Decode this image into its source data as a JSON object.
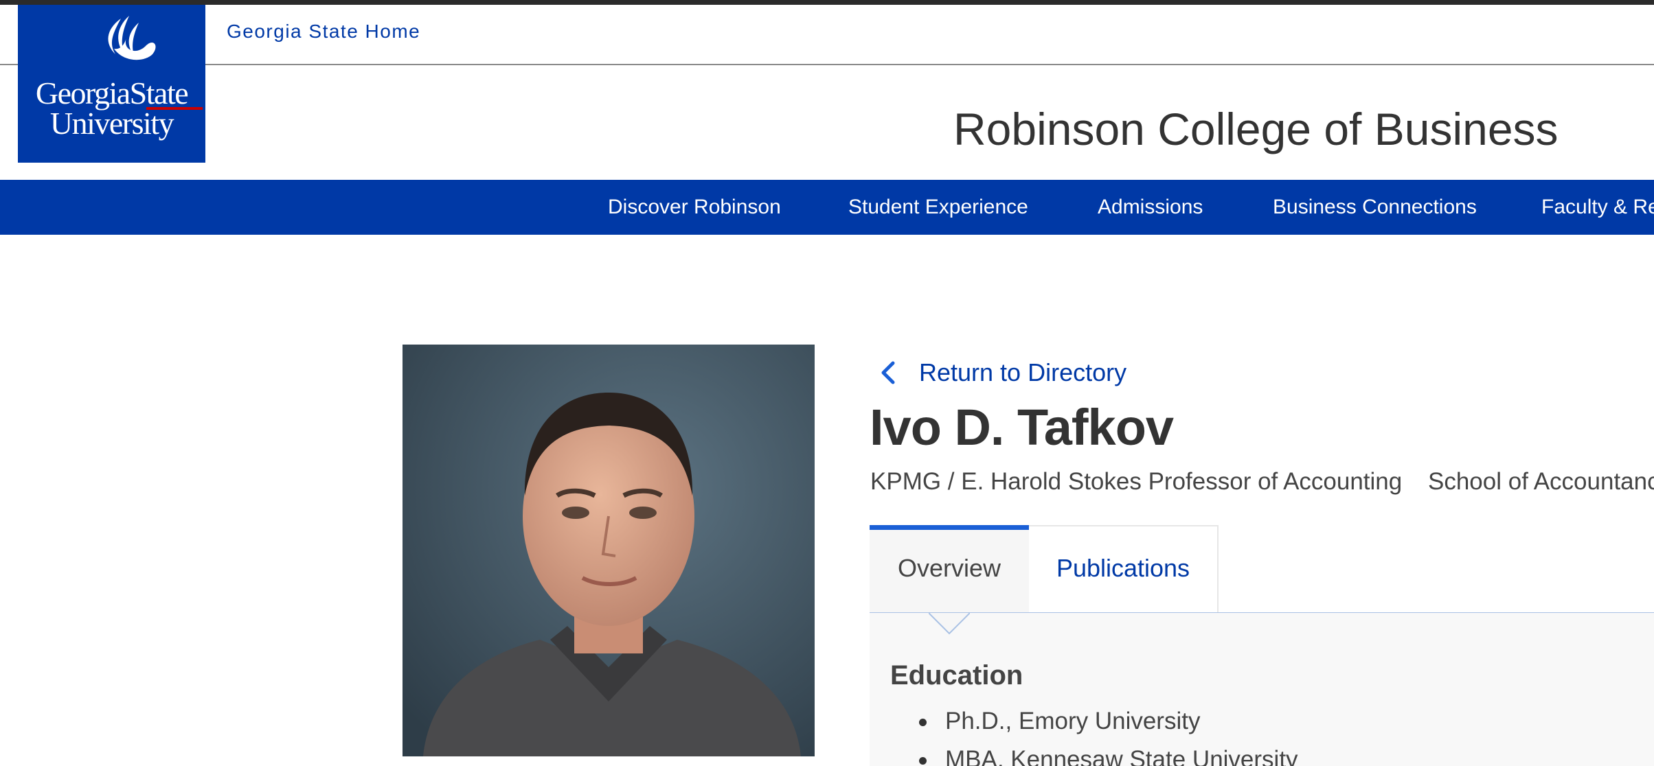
{
  "header": {
    "home_link": "Georgia State Home",
    "logo": {
      "line1": "GeorgiaState",
      "line2": "University",
      "icon": "flame-icon"
    },
    "college_title": "Robinson College of Business"
  },
  "nav": {
    "items": [
      {
        "label": "Discover Robinson"
      },
      {
        "label": "Student Experience"
      },
      {
        "label": "Admissions"
      },
      {
        "label": "Business Connections"
      },
      {
        "label": "Faculty & Re"
      }
    ]
  },
  "profile": {
    "back_link": "Return to Directory",
    "name": "Ivo D. Tafkov",
    "title": "KPMG / E. Harold Stokes Professor of Accounting",
    "department": "School of Accountancy",
    "photo_alt": "Portrait of Ivo D. Tafkov"
  },
  "tabs": [
    {
      "label": "Overview",
      "active": true
    },
    {
      "label": "Publications",
      "active": false
    }
  ],
  "overview": {
    "education_heading": "Education",
    "education": [
      "Ph.D., Emory University",
      "MBA, Kennesaw State University"
    ]
  },
  "colors": {
    "brand_blue": "#0039a6",
    "tab_accent": "#1a5fd6",
    "logo_red": "#cc0000"
  }
}
